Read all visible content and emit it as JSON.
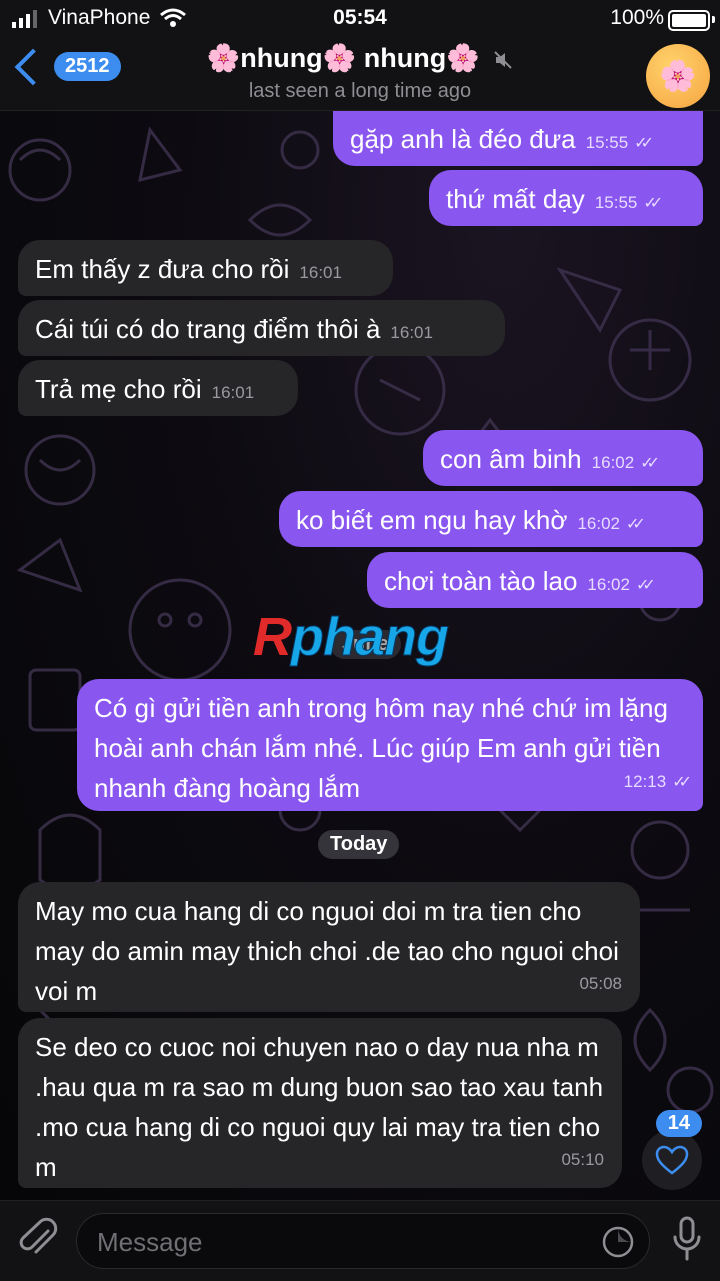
{
  "status_bar": {
    "carrier": "VinaPhone",
    "time": "05:54",
    "battery": "100%"
  },
  "header": {
    "back_count": "2512",
    "title": "🌸nhung🌸 nhung🌸",
    "subtitle": "last seen a long time ago",
    "avatar_emoji": "🌸"
  },
  "messages": [
    {
      "dir": "out",
      "text": "gặp anh là đéo đưa",
      "time": "15:55",
      "read": true
    },
    {
      "dir": "out",
      "text": "thứ mất dạy",
      "time": "15:55",
      "read": true
    },
    {
      "dir": "in",
      "text": "Em thấy z đưa cho rồi",
      "time": "16:01"
    },
    {
      "dir": "in",
      "text": "Cái túi có do trang điểm thôi à",
      "time": "16:01"
    },
    {
      "dir": "in",
      "text": "Trả mẹ cho rồi",
      "time": "16:01"
    },
    {
      "dir": "out",
      "text": "con âm binh",
      "time": "16:02",
      "read": true
    },
    {
      "dir": "out",
      "text": "ko biết em ngu hay khờ",
      "time": "16:02",
      "read": true
    },
    {
      "dir": "out",
      "text": "chơi toàn tào lao",
      "time": "16:02",
      "read": true
    },
    {
      "dir": "out",
      "text": "Có gì gửi tiền anh trong hôm nay nhé chứ im lặng hoài anh chán lắm nhé. Lúc giúp Em anh gửi tiền nhanh đàng hoàng lắm",
      "time": "12:13",
      "read": true
    },
    {
      "dir": "in",
      "text": "May mo cua hang di co nguoi doi m tra tien cho may do amin may thich choi .de tao cho nguoi choi voi m",
      "time": "05:08"
    },
    {
      "dir": "in",
      "text": "Se deo co cuoc noi chuyen nao o day nua nha m .hau qua m ra sao m dung buon sao tao xau tanh .mo cua hang di co nguoi quy lai may tra tien cho m",
      "time": "05:10"
    }
  ],
  "date_separators": {
    "june": "June",
    "today": "Today"
  },
  "watermark": {
    "first": "R",
    "rest": "phang"
  },
  "unread_reactions": "14",
  "input": {
    "placeholder": "Message"
  },
  "colors": {
    "outgoing": "#8a56f0",
    "incoming": "#262528",
    "accent": "#3d8df0"
  }
}
